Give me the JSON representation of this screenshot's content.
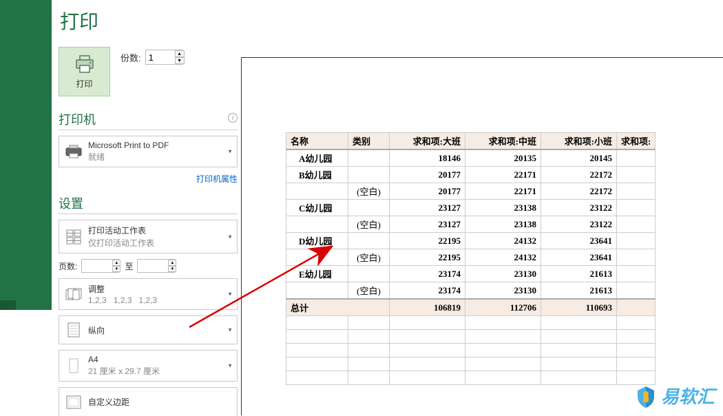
{
  "page_title": "打印",
  "print_button_label": "打印",
  "copies": {
    "label": "份数:",
    "value": "1"
  },
  "printer": {
    "section_label": "打印机",
    "name": "Microsoft Print to PDF",
    "status": "就绪",
    "props_link": "打印机属性"
  },
  "settings": {
    "section_label": "设置",
    "print_what": {
      "line1": "打印活动工作表",
      "line2": "仅打印活动工作表"
    },
    "page_range": {
      "label": "页数:",
      "to": "至"
    },
    "collate": {
      "line1": "调整",
      "line2": "1,2,3   1,2,3   1,2,3"
    },
    "orientation": {
      "line1": "纵向"
    },
    "paper": {
      "line1": "A4",
      "line2": "21 厘米 x 29.7 厘米"
    },
    "margins": {
      "line1": "自定义边距"
    }
  },
  "pivot": {
    "headers": [
      "名称",
      "类别",
      "求和项:大班",
      "求和项:中班",
      "求和项:小班",
      "求和项:"
    ],
    "blank_label": "(空白)",
    "total_label": "总计",
    "rows": [
      {
        "name": "A幼儿园",
        "d": "18146",
        "z": "20135",
        "x": "20145"
      },
      {
        "name": "B幼儿园",
        "d": "20177",
        "z": "22171",
        "x": "22172"
      },
      {
        "blank": true,
        "d": "20177",
        "z": "22171",
        "x": "22172"
      },
      {
        "name": "C幼儿园",
        "d": "23127",
        "z": "23138",
        "x": "23122"
      },
      {
        "blank": true,
        "d": "23127",
        "z": "23138",
        "x": "23122"
      },
      {
        "name": "D幼儿园",
        "d": "22195",
        "z": "24132",
        "x": "23641"
      },
      {
        "blank": true,
        "d": "22195",
        "z": "24132",
        "x": "23641"
      },
      {
        "name": "E幼儿园",
        "d": "23174",
        "z": "23130",
        "x": "21613"
      },
      {
        "blank": true,
        "d": "23174",
        "z": "23130",
        "x": "21613"
      }
    ],
    "total": {
      "d": "106819",
      "z": "112706",
      "x": "110693"
    }
  },
  "watermark": "易软汇"
}
